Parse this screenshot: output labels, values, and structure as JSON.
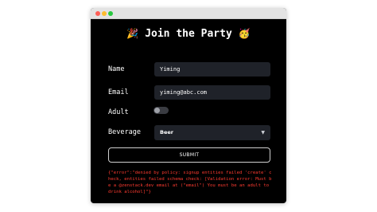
{
  "form": {
    "emoji_left": "🎉",
    "title": "Join the Party",
    "emoji_right": "🥳",
    "name_label": "Name",
    "name_value": "Yiming",
    "email_label": "Email",
    "email_value": "yiming@abc.com",
    "adult_label": "Adult",
    "adult_checked": false,
    "beverage_label": "Beverage",
    "beverage_value": "Beer",
    "submit_label": "SUBMIT"
  },
  "error_message": "{\"error\":\"denied by policy: signup entities failed 'create' check, entities failed schema check: [Validation error: Must be a @zenstack.dev email at (\"email\") You must be an adult to drink alcohol]\"}",
  "colors": {
    "background": "#000000",
    "input": "#1f2229",
    "error": "#ff3b30"
  }
}
